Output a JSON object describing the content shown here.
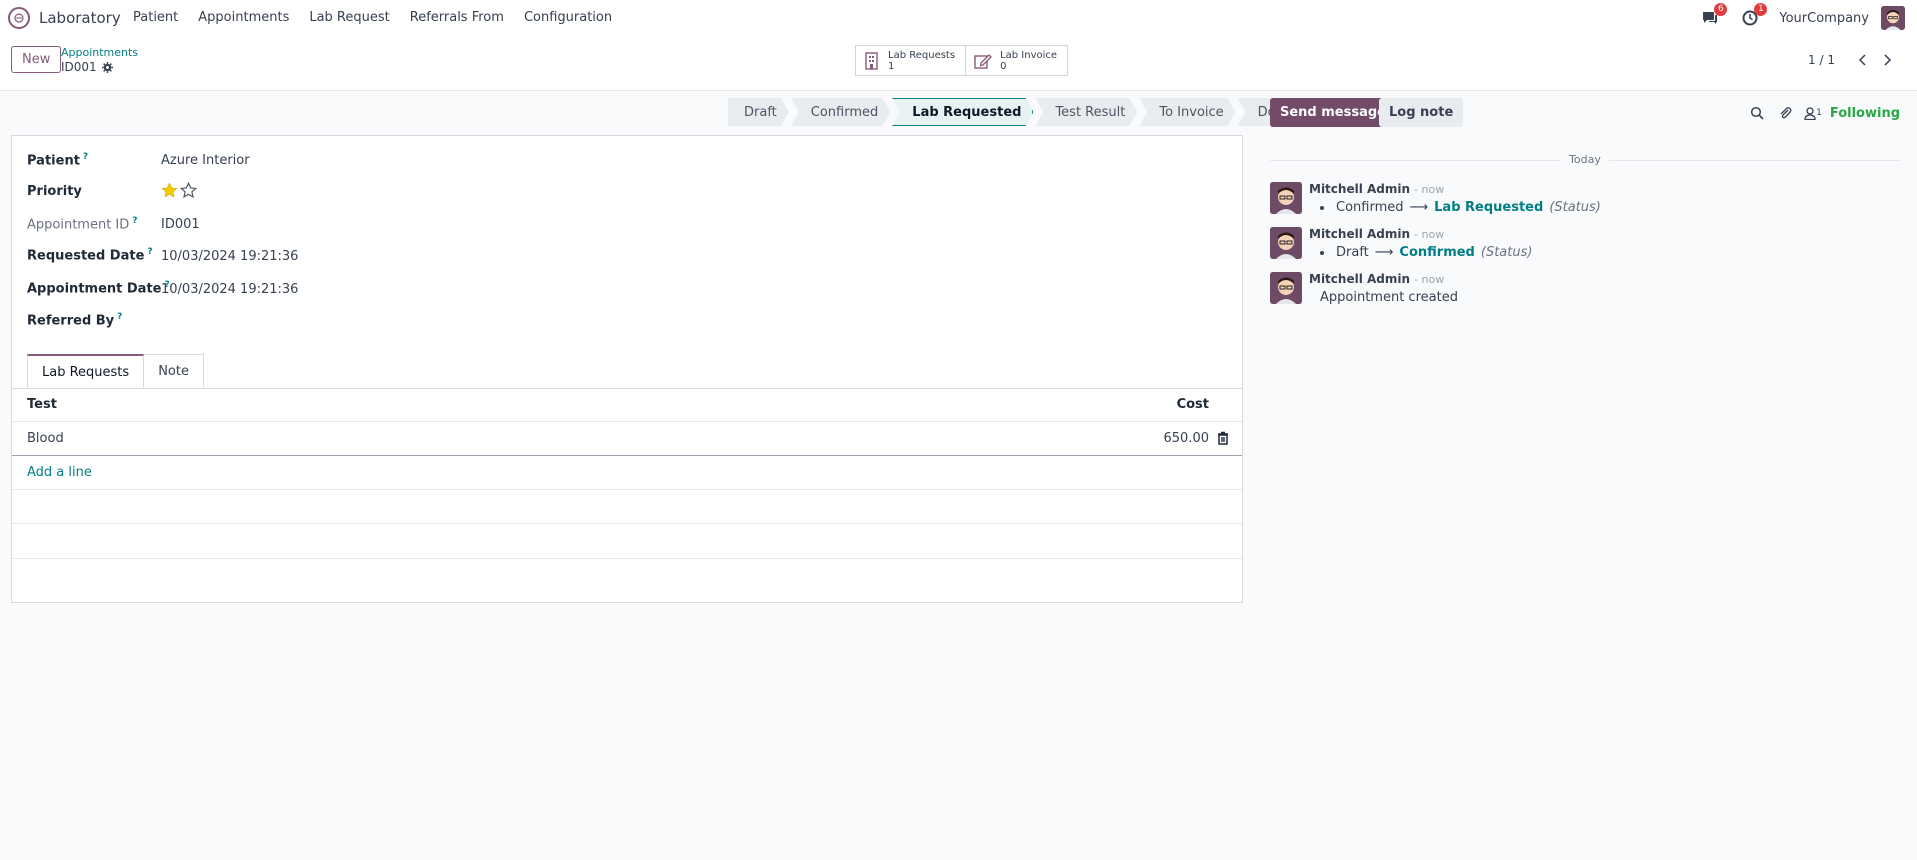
{
  "navbar": {
    "app_name": "Laboratory",
    "menu": [
      "Patient",
      "Appointments",
      "Lab Request",
      "Referrals From",
      "Configuration"
    ],
    "messages_badge": "6",
    "activities_badge": "1",
    "company": "YourCompany"
  },
  "control": {
    "new_label": "New",
    "breadcrumb_parent": "Appointments",
    "breadcrumb_current": "ID001",
    "smart_buttons": [
      {
        "label": "Lab Requests",
        "value": "1"
      },
      {
        "label": "Lab Invoice",
        "value": "0"
      }
    ],
    "pager": "1 / 1"
  },
  "statusbar": {
    "stages": [
      "Draft",
      "Confirmed",
      "Lab Requested",
      "Test Result",
      "To Invoice",
      "Done"
    ],
    "active": "Lab Requested"
  },
  "form": {
    "patient_label": "Patient",
    "patient_value": "Azure Interior",
    "priority_label": "Priority",
    "priority_stars": 1,
    "priority_max": 2,
    "appointment_id_label": "Appointment ID",
    "appointment_id_value": "ID001",
    "requested_date_label": "Requested Date",
    "requested_date_value": "10/03/2024 19:21:36",
    "appointment_date_label": "Appointment Date",
    "appointment_date_value": "10/03/2024 19:21:36",
    "referred_by_label": "Referred By",
    "help_mark": "?",
    "tabs": [
      "Lab Requests",
      "Note"
    ],
    "table": {
      "col_test": "Test",
      "col_cost": "Cost",
      "rows": [
        {
          "test": "Blood",
          "cost": "650.00"
        }
      ],
      "add_line": "Add a line"
    }
  },
  "chatter": {
    "send_message": "Send message",
    "log_note": "Log note",
    "followers_count": "1",
    "following": "Following",
    "day": "Today",
    "messages": [
      {
        "author": "Mitchell Admin",
        "time": "- now",
        "old": "Confirmed",
        "arrow": "⟶",
        "new": "Lab Requested",
        "field": "(Status)"
      },
      {
        "author": "Mitchell Admin",
        "time": "- now",
        "old": "Draft",
        "arrow": "⟶",
        "new": "Confirmed",
        "field": "(Status)"
      },
      {
        "author": "Mitchell Admin",
        "time": "- now",
        "text": "Appointment created"
      }
    ]
  },
  "colors": {
    "brand": "#714b67",
    "link": "#017e84",
    "star": "#f3cc00",
    "following": "#28a745"
  }
}
